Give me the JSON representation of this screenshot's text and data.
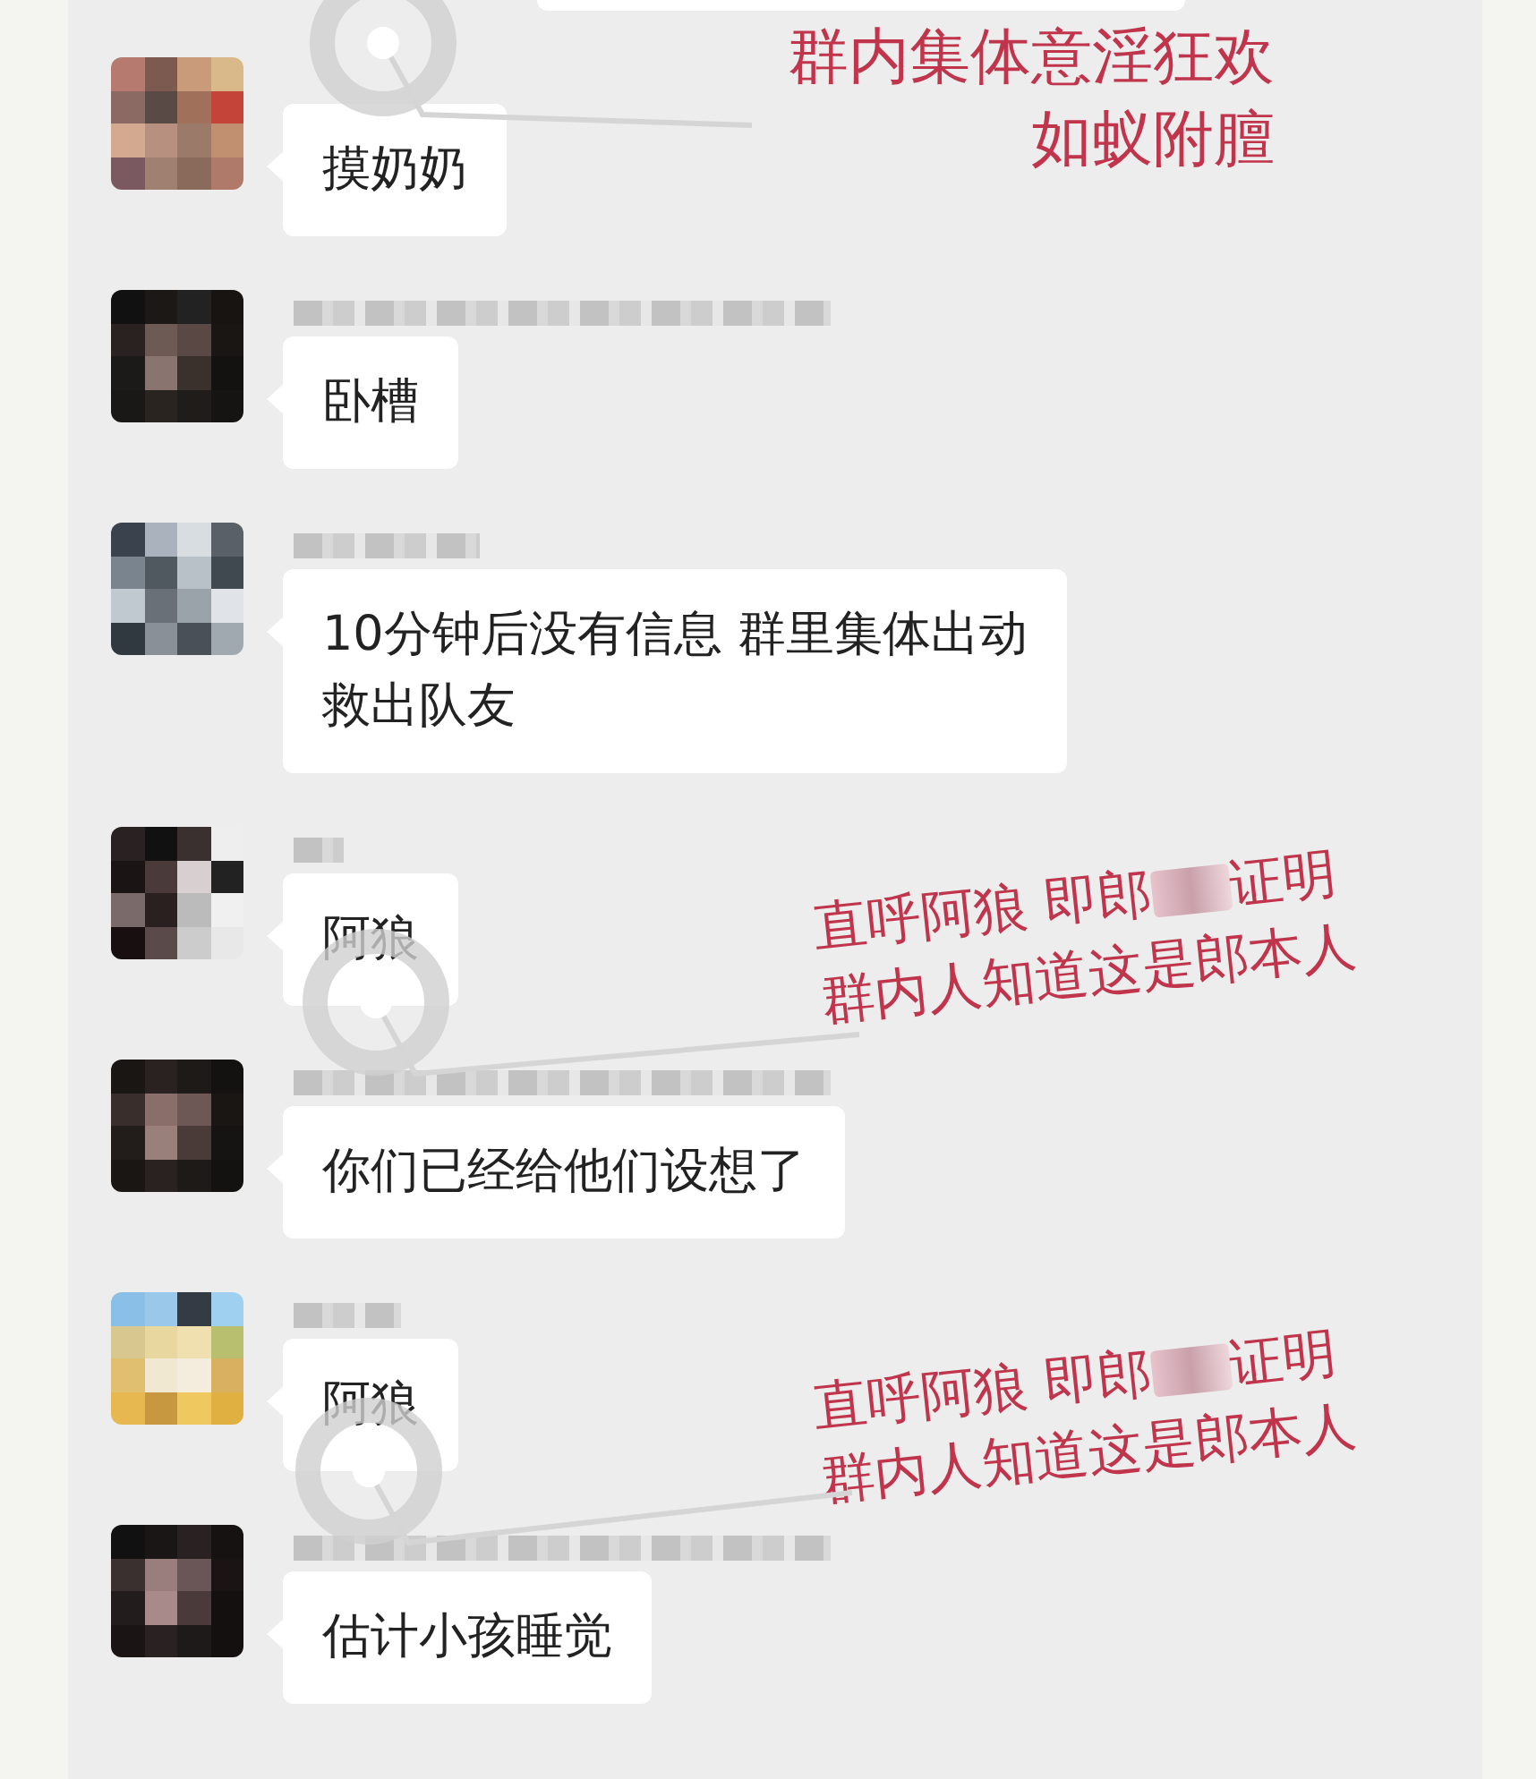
{
  "messages": [
    {
      "text": "摸奶奶",
      "name_blurred": false
    },
    {
      "text": "卧槽",
      "name_blurred": true
    },
    {
      "text": [
        "10分钟后没有信息 群里集体出动",
        "救出队友"
      ],
      "name_blurred": true
    },
    {
      "text": "阿狼",
      "name_blurred": true
    },
    {
      "text": "你们已经给他们设想了",
      "name_blurred": true
    },
    {
      "text": "阿狼",
      "name_blurred": true
    },
    {
      "text": "估计小孩睡觉",
      "name_blurred": true
    }
  ],
  "annotations": [
    {
      "lines": [
        {
          "parts": [
            "群内集体意淫狂欢"
          ]
        },
        {
          "parts": [
            "如蚁附膻"
          ]
        }
      ]
    },
    {
      "lines": [
        {
          "parts": [
            "直呼阿狼 即郎",
            "证明"
          ]
        },
        {
          "parts": [
            "群内人知道这是郎本人"
          ]
        }
      ]
    },
    {
      "lines": [
        {
          "parts": [
            "直呼阿狼 即郎",
            "证明"
          ]
        },
        {
          "parts": [
            "群内人知道这是郎本人"
          ]
        }
      ]
    }
  ]
}
